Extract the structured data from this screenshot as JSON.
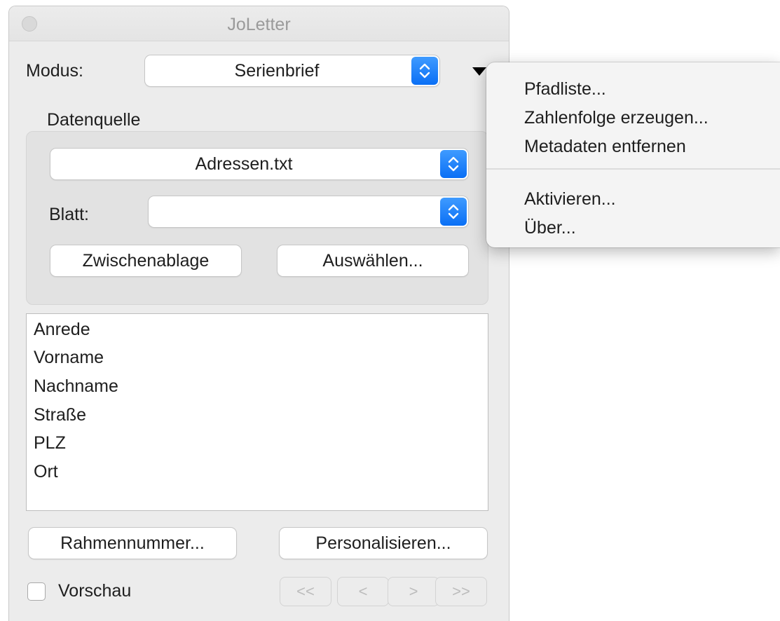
{
  "window": {
    "title": "JoLetter"
  },
  "modus": {
    "label": "Modus:",
    "value": "Serienbrief"
  },
  "datenquelle": {
    "heading": "Datenquelle",
    "file_value": "Adressen.txt",
    "blatt_label": "Blatt:",
    "blatt_value": "",
    "clipboard_button": "Zwischenablage",
    "choose_button": "Auswählen..."
  },
  "fields": [
    "Anrede",
    "Vorname",
    "Nachname",
    "Straße",
    "PLZ",
    "Ort"
  ],
  "actions": {
    "frame_number_button": "Rahmennummer...",
    "personalize_button": "Personalisieren..."
  },
  "preview": {
    "label": "Vorschau",
    "checked": false
  },
  "navigation": {
    "first": "<<",
    "prev": "<",
    "next": ">",
    "last": ">>"
  },
  "menu": {
    "items_top": [
      "Pfadliste...",
      "Zahlenfolge erzeugen...",
      "Metadaten entfernen"
    ],
    "items_bottom": [
      "Aktivieren...",
      "Über..."
    ]
  },
  "colors": {
    "accent": "#0a6ff5",
    "window_bg": "#ececec",
    "group_bg": "#e2e2e2"
  }
}
